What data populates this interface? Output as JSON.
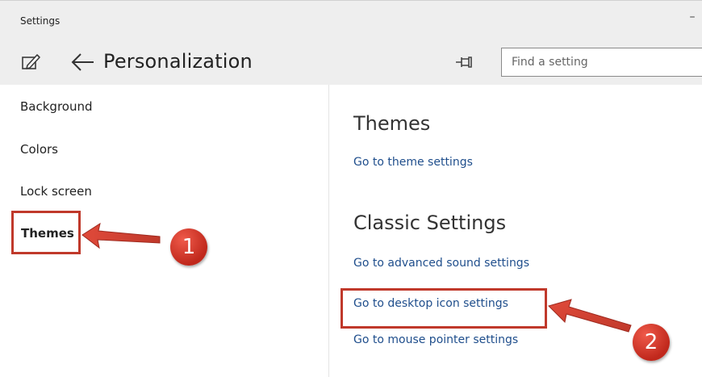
{
  "window": {
    "title": "Settings",
    "minimize_glyph": "–"
  },
  "header": {
    "page_title": "Personalization",
    "search_placeholder": "Find a setting",
    "icons": [
      "edit-icon",
      "back-arrow-icon",
      "pin-icon"
    ]
  },
  "sidebar": {
    "items": [
      {
        "label": "Background"
      },
      {
        "label": "Colors"
      },
      {
        "label": "Lock screen"
      },
      {
        "label": "Themes",
        "selected": true
      }
    ]
  },
  "content": {
    "themes_heading": "Themes",
    "theme_link": "Go to theme settings",
    "classic_heading": "Classic Settings",
    "classic_links": [
      {
        "label": "Go to advanced sound settings"
      },
      {
        "label": "Go to desktop icon settings",
        "highlighted": true
      },
      {
        "label": "Go to mouse pointer settings"
      }
    ]
  },
  "annotations": {
    "step1": "1",
    "step2": "2",
    "accent_color": "#c0392b"
  }
}
